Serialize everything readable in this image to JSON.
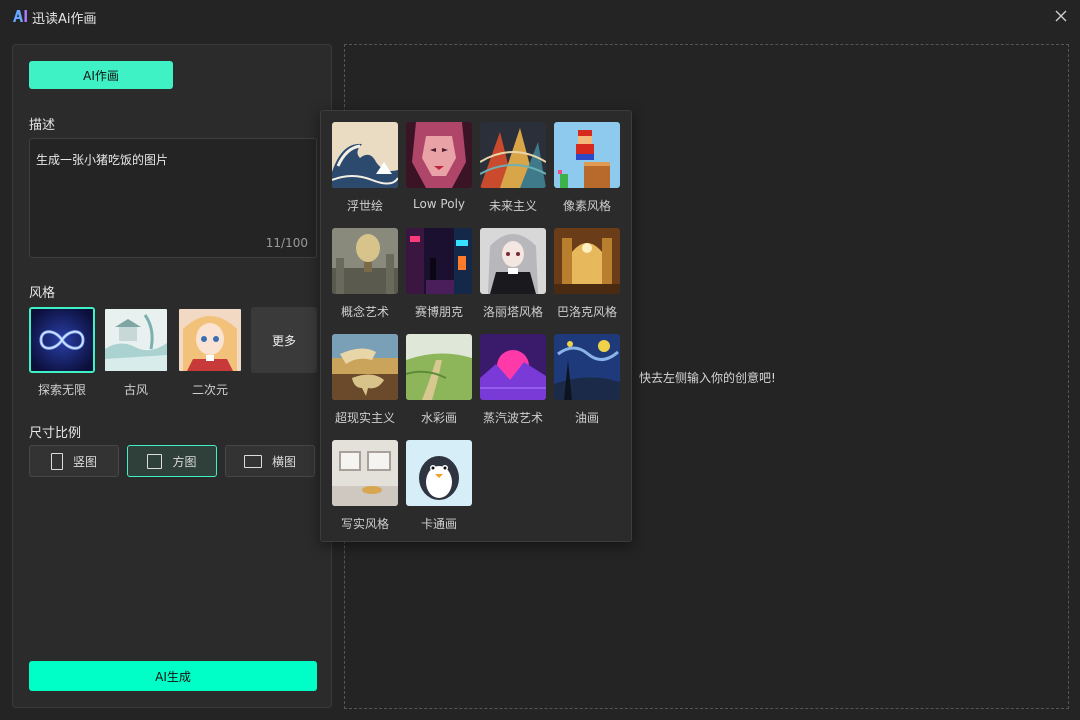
{
  "window": {
    "title": "迅读Ai作画",
    "logo_text": "AI"
  },
  "left": {
    "tab_label": "AI作画",
    "description": {
      "label": "描述",
      "value": "生成一张小猪吃饭的图片",
      "counter": "11/100"
    },
    "style": {
      "label": "风格",
      "items": [
        {
          "name": "探索无限",
          "icon": "infinity-thumb",
          "selected": true
        },
        {
          "name": "古风",
          "icon": "ancient-landscape-thumb",
          "selected": false
        },
        {
          "name": "二次元",
          "icon": "anime-girl-thumb",
          "selected": false
        }
      ],
      "more_label": "更多"
    },
    "ratio": {
      "label": "尺寸比例",
      "options": [
        {
          "label": "竖图",
          "icon": "portrait-rect-icon",
          "selected": false
        },
        {
          "label": "方图",
          "icon": "square-rect-icon",
          "selected": true
        },
        {
          "label": "横图",
          "icon": "landscape-rect-icon",
          "selected": false
        }
      ]
    },
    "generate_label": "AI生成"
  },
  "canvas": {
    "hint": "快去左侧输入你的创意吧!"
  },
  "style_popup": {
    "items": [
      {
        "name": "浮世绘",
        "icon": "great-wave-thumb"
      },
      {
        "name": "Low Poly",
        "icon": "lowpoly-portrait-thumb"
      },
      {
        "name": "未来主义",
        "icon": "futurism-thumb"
      },
      {
        "name": "像素风格",
        "icon": "pixel-mario-thumb"
      },
      {
        "name": "概念艺术",
        "icon": "concept-airship-thumb"
      },
      {
        "name": "赛博朋克",
        "icon": "cyberpunk-street-thumb"
      },
      {
        "name": "洛丽塔风格",
        "icon": "lolita-girl-thumb"
      },
      {
        "name": "巴洛克风格",
        "icon": "baroque-hall-thumb"
      },
      {
        "name": "超现实主义",
        "icon": "melting-clock-thumb"
      },
      {
        "name": "水彩画",
        "icon": "watercolor-field-thumb"
      },
      {
        "name": "蒸汽波艺术",
        "icon": "vaporwave-sun-thumb"
      },
      {
        "name": "油画",
        "icon": "starry-night-thumb"
      },
      {
        "name": "写实风格",
        "icon": "realistic-room-thumb"
      },
      {
        "name": "卡通画",
        "icon": "cartoon-penguin-thumb"
      }
    ]
  },
  "colors": {
    "accent": "#3ef2c6",
    "generate": "#00ffc6",
    "background": "#242424",
    "panel": "#2b2b2b"
  }
}
